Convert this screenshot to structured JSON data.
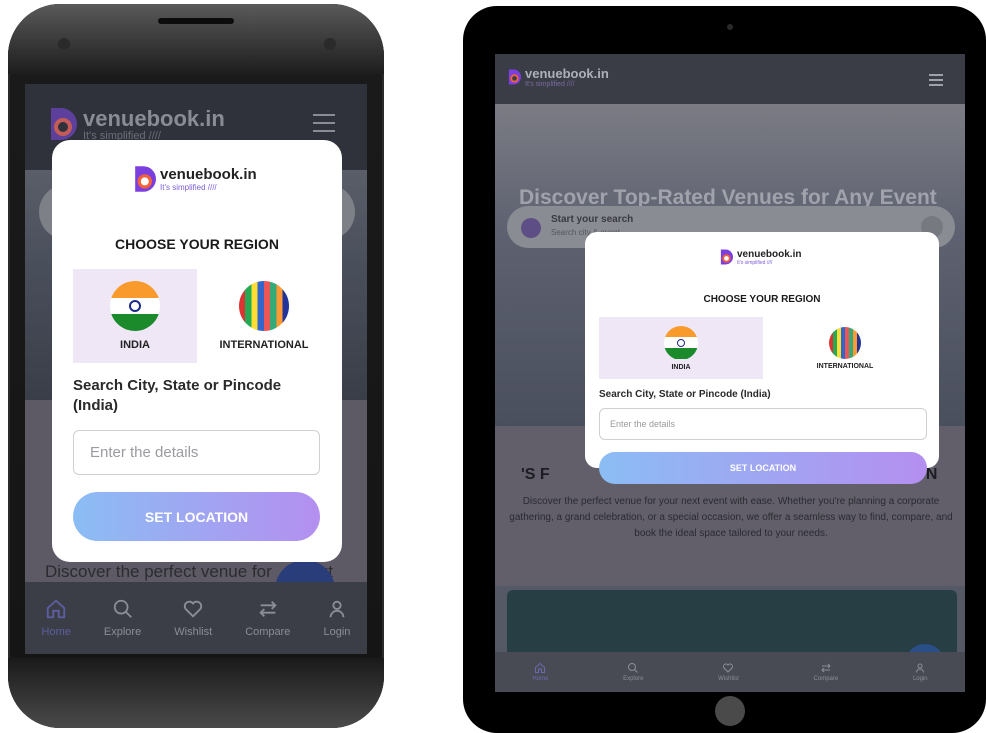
{
  "brand": {
    "name": "venuebook.in",
    "tagline": "It's simplified ////"
  },
  "modal": {
    "title": "CHOOSE YOUR REGION",
    "regions": [
      {
        "label": "INDIA",
        "selected": true,
        "icon": "india-flag-icon"
      },
      {
        "label": "INTERNATIONAL",
        "selected": false,
        "icon": "world-flags-globe-icon"
      }
    ],
    "search_label": "Search City, State or Pincode (India)",
    "input_placeholder": "Enter the details",
    "button_label": "SET LOCATION"
  },
  "phone": {
    "hero_text": "Discover the perfect venue for",
    "hero_text_tail": "xt"
  },
  "tablet": {
    "hero_title": "Discover Top-Rated Venues for Any Event",
    "search_title": "Start your search",
    "search_sub": "Search city & event",
    "section_left": "'S F",
    "section_right": "ION",
    "paragraph": "Discover the perfect venue for your next event with ease. Whether you're planning a corporate gathering, a grand celebration, or a special occasion, we offer a seamless way to find, compare, and book the ideal space tailored to your needs."
  },
  "nav": [
    {
      "label": "Home",
      "icon": "home-icon",
      "active": true
    },
    {
      "label": "Explore",
      "icon": "search-icon",
      "active": false
    },
    {
      "label": "Wishlist",
      "icon": "heart-icon",
      "active": false
    },
    {
      "label": "Compare",
      "icon": "compare-arrows-icon",
      "active": false
    },
    {
      "label": "Login",
      "icon": "user-icon",
      "active": false
    }
  ],
  "colors": {
    "accent_purple": "#7b5cd8",
    "selected_region_bg": "#efe6f6",
    "button_gradient_start": "#8bbdf4",
    "button_gradient_end": "#b48ff0",
    "nav_active": "#5d5ea0"
  }
}
